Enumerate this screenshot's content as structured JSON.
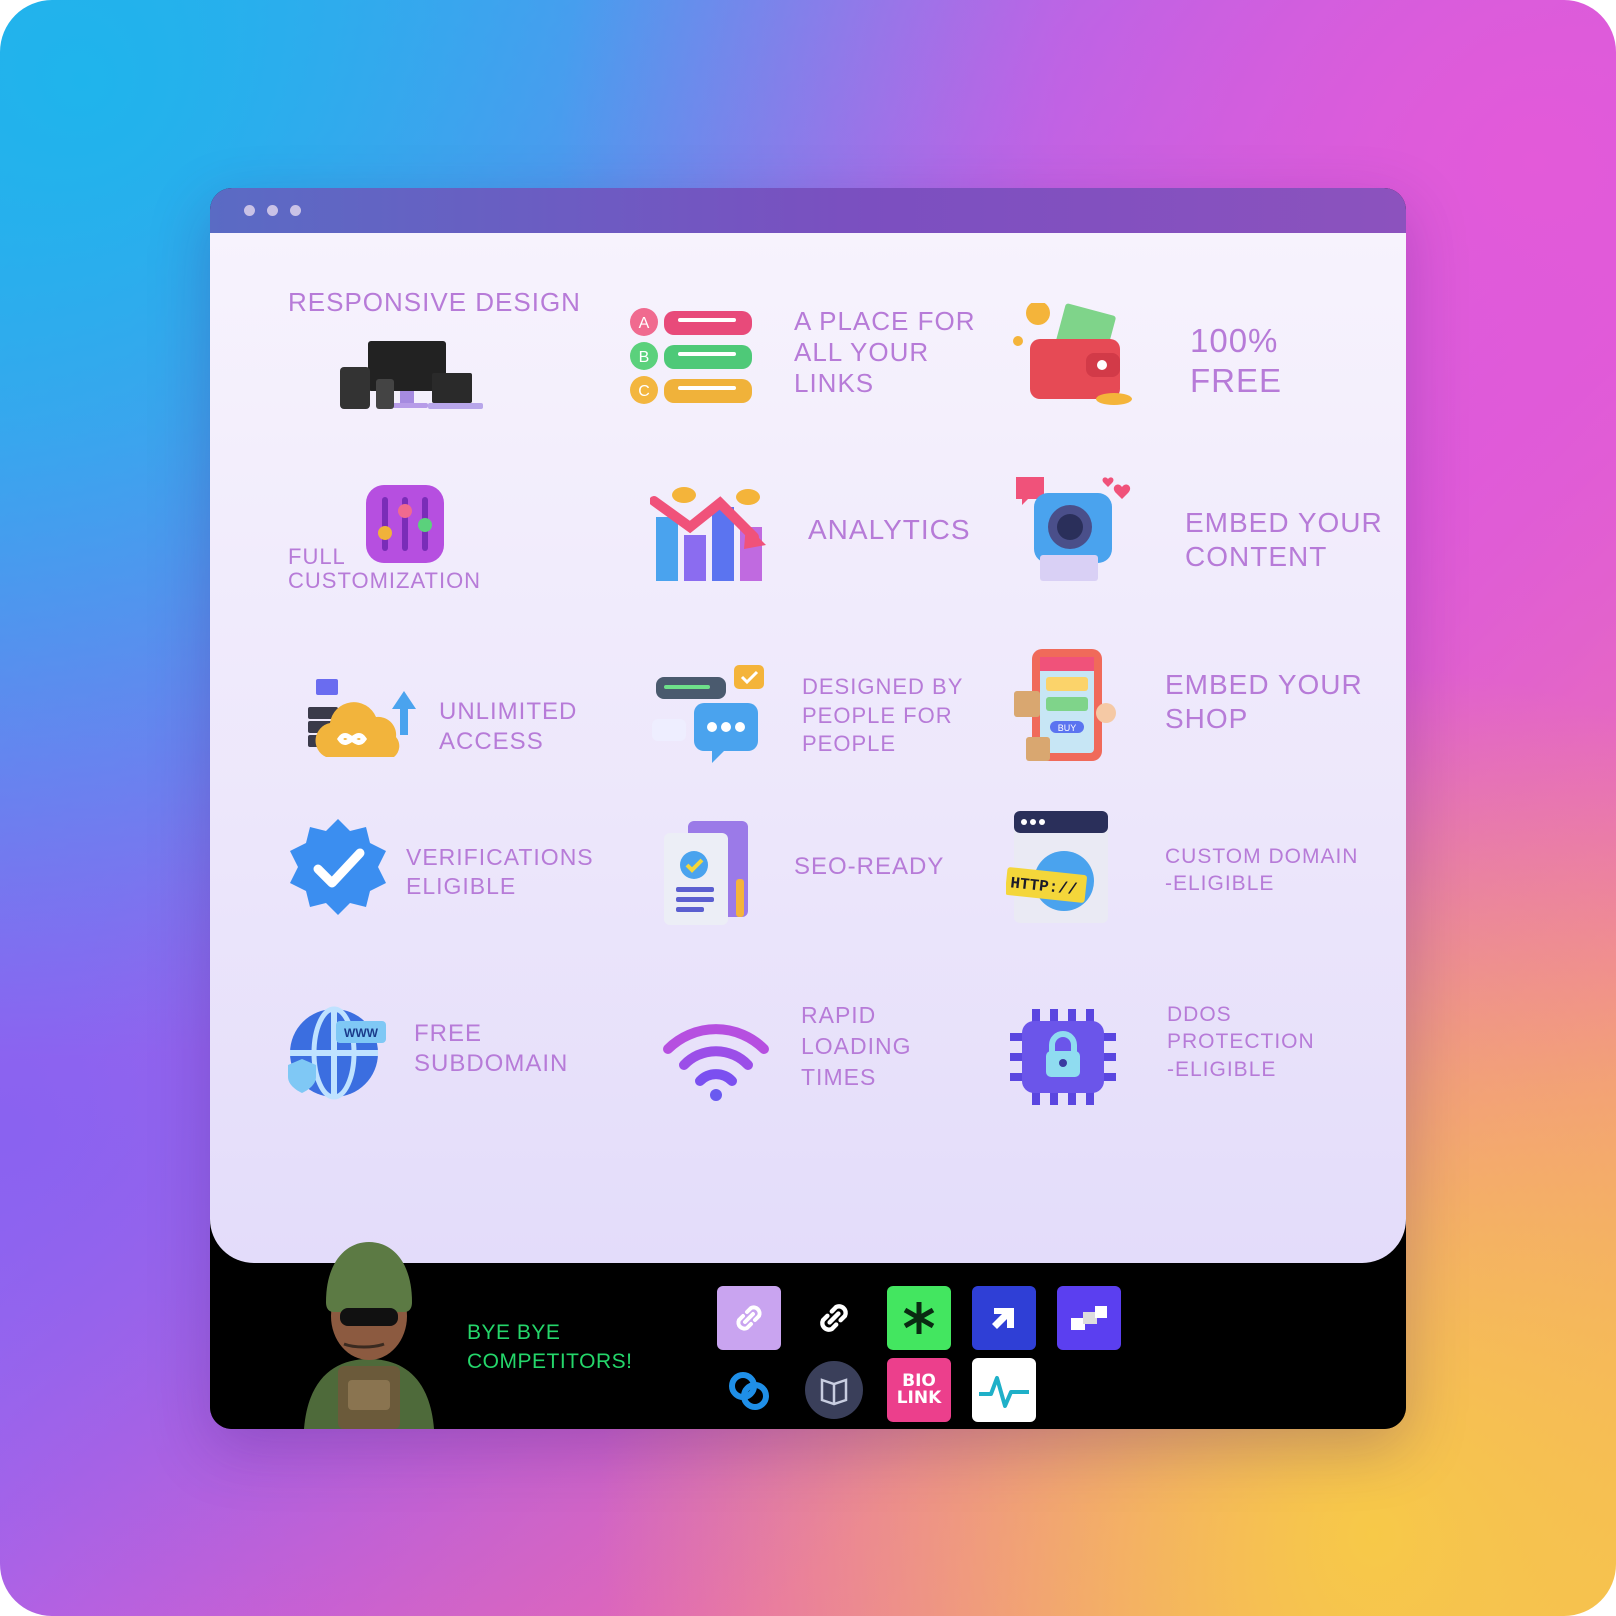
{
  "features": {
    "responsive_design": "RESPONSIVE DESIGN",
    "links_1": "A PLACE FOR",
    "links_2": "ALL YOUR",
    "links_3": "LINKS",
    "free_1": "100%",
    "free_2": "FREE",
    "custom_1": "FULL",
    "custom_2": "CUSTOMIZATION",
    "analytics": "ANALYTICS",
    "embed_content_1": "EMBED YOUR",
    "embed_content_2": "CONTENT",
    "unlimited_1": "UNLIMITED",
    "unlimited_2": "ACCESS",
    "designed_1": "DESIGNED BY",
    "designed_2": "PEOPLE FOR",
    "designed_3": "PEOPLE",
    "embed_shop_1": "EMBED YOUR",
    "embed_shop_2": "SHOP",
    "verif_1": "VERIFICATIONS",
    "verif_2": "ELIGIBLE",
    "seo": "SEO-READY",
    "domain_1": "CUSTOM DOMAIN",
    "domain_2": "-ELIGIBLE",
    "subdomain_1": "FREE",
    "subdomain_2": "SUBDOMAIN",
    "rapid_1": "RAPID",
    "rapid_2": "LOADING",
    "rapid_3": "TIMES",
    "ddos_1": "DDOS",
    "ddos_2": "PROTECTION",
    "ddos_3": "-ELIGIBLE"
  },
  "icons": {
    "abc_a": "A",
    "abc_b": "B",
    "abc_c": "C",
    "http": "HTTP://",
    "www": "WWW",
    "buy": "BUY"
  },
  "footer": {
    "bye_1": "BYE BYE",
    "bye_2": "COMPETITORS!",
    "biolink_1": "BIO",
    "biolink_2": "LINK"
  },
  "colors": {
    "feature_text": "#b77bd8",
    "footer_text": "#24d66a",
    "titlebar_left": "#5a6bc4",
    "titlebar_right": "#8c52be"
  }
}
